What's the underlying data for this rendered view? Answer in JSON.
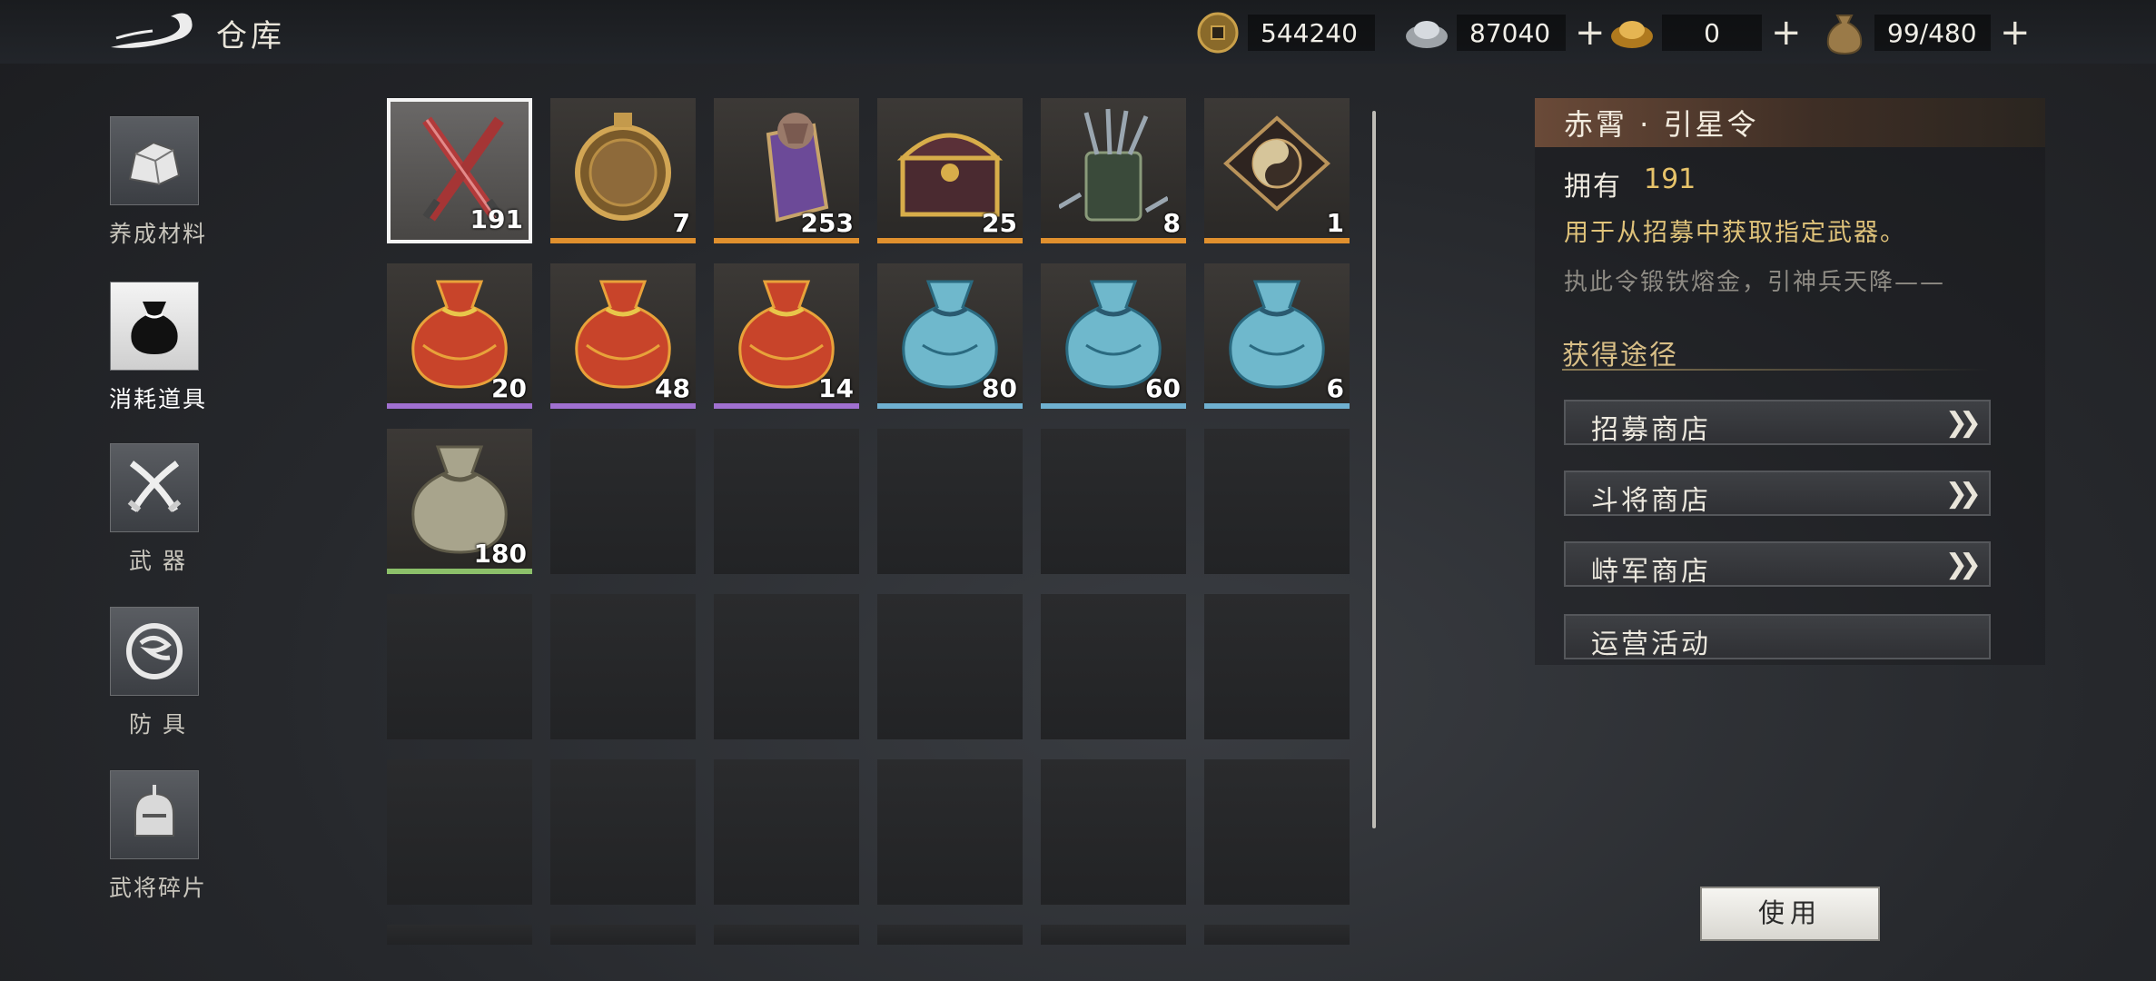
{
  "header": {
    "title": "仓库"
  },
  "currencies": [
    {
      "name": "copper-coin",
      "value": "544240",
      "has_plus": false
    },
    {
      "name": "silver-ingot",
      "value": "87040",
      "has_plus": true
    },
    {
      "name": "gold-ingot",
      "value": "0",
      "has_plus": true
    },
    {
      "name": "bag-capacity",
      "value": "99/480",
      "has_plus": true
    }
  ],
  "nav": [
    {
      "label": "养成材料",
      "icon": "stone-icon",
      "active": false
    },
    {
      "label": "消耗道具",
      "icon": "pouch-icon",
      "active": true
    },
    {
      "label": "武 器",
      "icon": "crossed-swords-icon",
      "active": false
    },
    {
      "label": "防 具",
      "icon": "dragon-emblem-icon",
      "active": false
    },
    {
      "label": "武将碎片",
      "icon": "general-helmet-icon",
      "active": false
    }
  ],
  "items": [
    {
      "count": "191",
      "icon": "crossed-blades-icon",
      "rarity": "#c0504d",
      "selected": true
    },
    {
      "count": "7",
      "icon": "bronze-mirror-icon",
      "rarity": "#e0902e"
    },
    {
      "count": "253",
      "icon": "purple-token-icon",
      "rarity": "#e0902e"
    },
    {
      "count": "25",
      "icon": "treasure-chest-icon",
      "rarity": "#e0902e"
    },
    {
      "count": "8",
      "icon": "brush-holder-icon",
      "rarity": "#e0902e"
    },
    {
      "count": "1",
      "icon": "bagua-plate-icon",
      "rarity": "#e0902e"
    },
    {
      "count": "20",
      "icon": "red-pouch-icon",
      "rarity": "#a070d0"
    },
    {
      "count": "48",
      "icon": "red-pouch-icon",
      "rarity": "#a070d0"
    },
    {
      "count": "14",
      "icon": "red-pouch-icon",
      "rarity": "#a070d0"
    },
    {
      "count": "80",
      "icon": "blue-pouch-icon",
      "rarity": "#6fb0d0"
    },
    {
      "count": "60",
      "icon": "blue-pouch-icon",
      "rarity": "#6fb0d0"
    },
    {
      "count": "6",
      "icon": "blue-pouch-icon",
      "rarity": "#6fb0d0"
    },
    {
      "count": "180",
      "icon": "grey-pouch-icon",
      "rarity": "#8cc06a"
    }
  ],
  "detail": {
    "title": "赤霄 · 引星令",
    "owned_label": "拥有",
    "owned_value": "191",
    "description": "用于从招募中获取指定武器。",
    "flavor": "执此令锻铁熔金，引神兵天降——",
    "source_title": "获得途径",
    "sources": [
      {
        "label": "招募商店",
        "has_arrow": true
      },
      {
        "label": "斗将商店",
        "has_arrow": true
      },
      {
        "label": "峙军商店",
        "has_arrow": true
      },
      {
        "label": "运营活动",
        "has_arrow": false
      }
    ],
    "use_label": "使用"
  }
}
